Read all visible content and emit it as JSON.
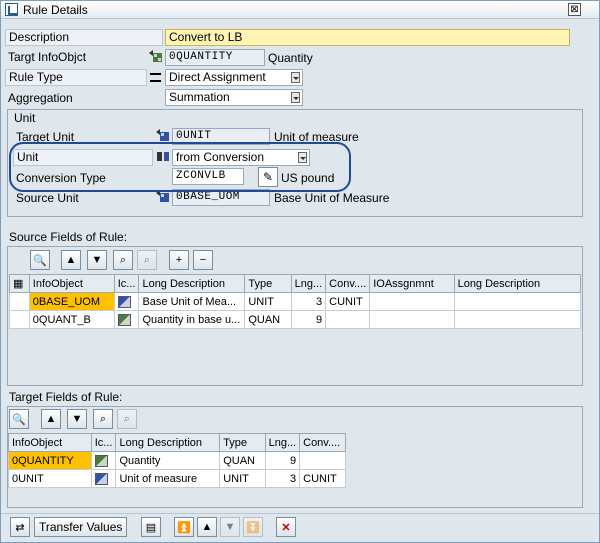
{
  "window": {
    "title": "Rule Details",
    "close_glyph": "⊠"
  },
  "form": {
    "description_label": "Description",
    "description_value": "Convert to LB",
    "target_infoobject_label": "Targt InfoObjct",
    "target_infoobject_value": "0QUANTITY",
    "target_infoobject_text": "Quantity",
    "rule_type_label": "Rule Type",
    "rule_type_value": "Direct Assignment",
    "aggregation_label": "Aggregation",
    "aggregation_value": "Summation"
  },
  "unit_group": {
    "title": "Unit",
    "target_unit_label": "Target Unit",
    "target_unit_value": "0UNIT",
    "target_unit_text": "Unit of measure",
    "unit_label": "Unit",
    "unit_value": "from Conversion",
    "conversion_type_label": "Conversion Type",
    "conversion_type_value": "ZCONVLB",
    "conversion_type_text": "US pound",
    "source_unit_label": "Source Unit",
    "source_unit_value": "0BASE_UOM",
    "source_unit_text": "Base Unit of Measure"
  },
  "source_fields": {
    "title": "Source Fields of Rule:",
    "headers": [
      "InfoObject",
      "Ic...",
      "Long Description",
      "Type",
      "Lng...",
      "Conv....",
      "IOAssgnmnt",
      "Long Description"
    ],
    "rows": [
      {
        "infoobject": "0BASE_UOM",
        "long_desc": "Base Unit of Mea...",
        "type": "UNIT",
        "length": "3",
        "conv": "CUNIT",
        "ioassign": "",
        "long_desc2": ""
      },
      {
        "infoobject": "0QUANT_B",
        "long_desc": "Quantity in base u...",
        "type": "QUAN",
        "length": "9",
        "conv": "",
        "ioassign": "",
        "long_desc2": ""
      }
    ]
  },
  "target_fields": {
    "title": "Target Fields of Rule:",
    "headers": [
      "InfoObject",
      "Ic...",
      "Long Description",
      "Type",
      "Lng...",
      "Conv...."
    ],
    "rows": [
      {
        "infoobject": "0QUANTITY",
        "long_desc": "Quantity",
        "type": "QUAN",
        "length": "9",
        "conv": ""
      },
      {
        "infoobject": "0UNIT",
        "long_desc": "Unit of measure",
        "type": "UNIT",
        "length": "3",
        "conv": "CUNIT"
      }
    ]
  },
  "bottom": {
    "transfer_values_label": "Transfer Values"
  },
  "colors": {
    "highlight_oval": "#1f4a99",
    "selected_cell": "#ffc000",
    "description_bg": "#fff4b3"
  }
}
